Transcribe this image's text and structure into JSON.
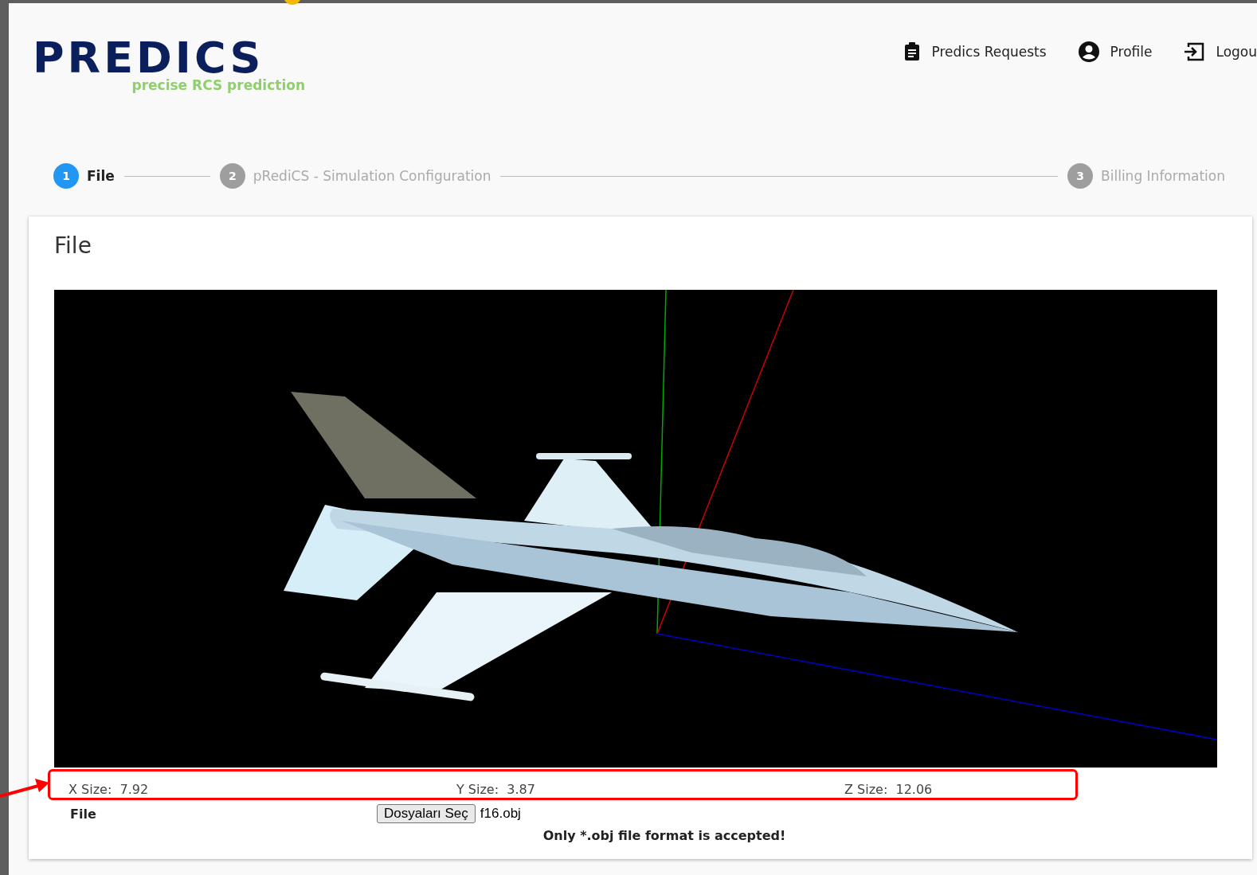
{
  "logo": {
    "name": "PREDICS",
    "tagline": "precise RCS prediction"
  },
  "nav": [
    {
      "kind": "clipboard",
      "label": "Predics Requests"
    },
    {
      "kind": "user",
      "label": "Profile"
    },
    {
      "kind": "logout",
      "label": "Logou"
    }
  ],
  "steps": [
    {
      "number": "1",
      "label": "File",
      "selected": true
    },
    {
      "number": "2",
      "label": "pRediCS - Simulation Configuration",
      "selected": false
    },
    {
      "number": "3",
      "label": "Billing Information",
      "selected": false
    }
  ],
  "card": {
    "title": "File",
    "sizes": [
      {
        "label": "X Size:",
        "value": "7.92"
      },
      {
        "label": "Y Size:",
        "value": "3.87"
      },
      {
        "label": "Z Size:",
        "value": "12.06"
      }
    ],
    "file_label": "File",
    "choose_button": "Dosyaları Seç",
    "file_name": "f16.obj",
    "hint": "Only *.obj file format is accepted!"
  }
}
